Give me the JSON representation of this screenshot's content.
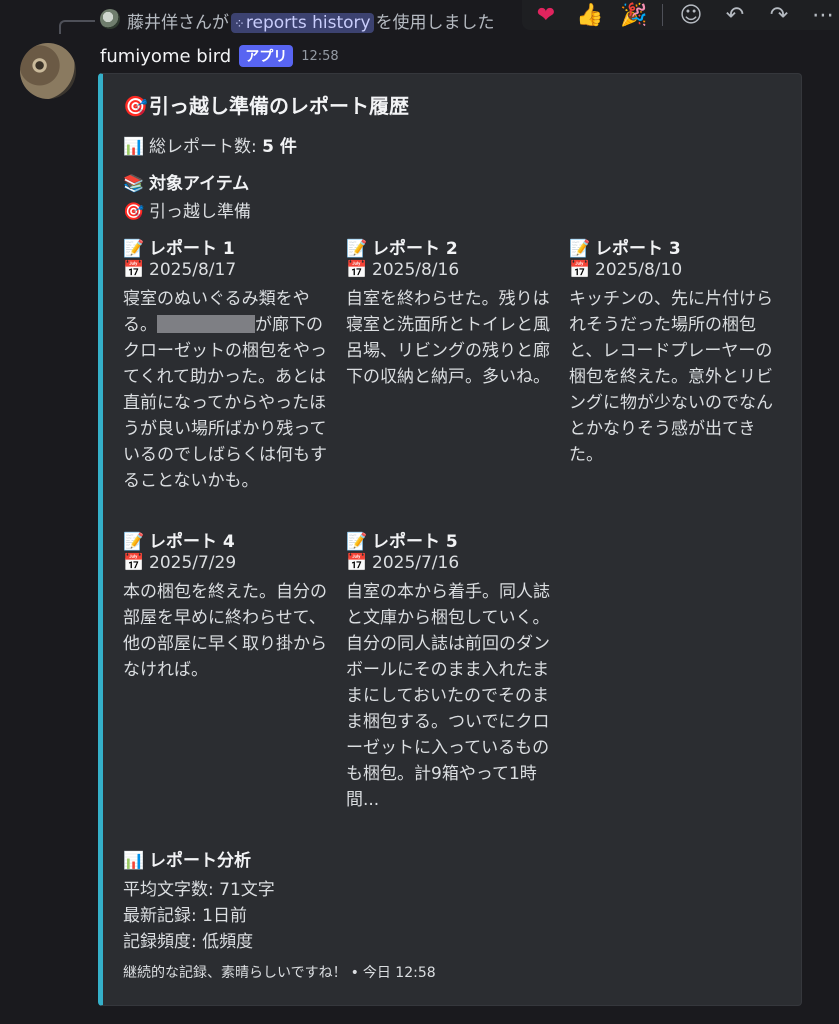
{
  "reply": {
    "user_text": "藤井佯さんが",
    "command": "reports history",
    "suffix": "を使用しました"
  },
  "toolbar": {
    "reactions": [
      "heart",
      "thumbs-up",
      "party-popper"
    ],
    "actions": [
      "add-reaction",
      "reply",
      "forward",
      "more"
    ]
  },
  "message": {
    "author": "fumiyome bird",
    "badge": "アプリ",
    "time": "12:58"
  },
  "embed": {
    "accent_color": "#35b0c9",
    "title": "引っ越し準備のレポート履歴",
    "total_label": "総レポート数:",
    "total_value": "5 件",
    "target_heading": "対象アイテム",
    "target_item": "引っ越し準備",
    "reports": [
      {
        "name": "レポート 1",
        "date": "2025/8/17",
        "text_before": "寝室のぬいぐるみ類をやる。",
        "text_after": "が廊下のクローゼットの梱包をやってくれて助かった。あとは直前になってからやったほうが良い場所ばかり残っているのでしばらくは何もすることないかも。"
      },
      {
        "name": "レポート 2",
        "date": "2025/8/16",
        "text": "自室を終わらせた。残りは寝室と洗面所とトイレと風呂場、リビングの残りと廊下の収納と納戸。多いね。"
      },
      {
        "name": "レポート 3",
        "date": "2025/8/10",
        "text": "キッチンの、先に片付けられそうだった場所の梱包と、レコードプレーヤーの梱包を終えた。意外とリビングに物が少ないのでなんとかなりそう感が出てきた。"
      },
      {
        "name": "レポート 4",
        "date": "2025/7/29",
        "text": "本の梱包を終えた。自分の部屋を早めに終わらせて、他の部屋に早く取り掛からなければ。"
      },
      {
        "name": "レポート 5",
        "date": "2025/7/16",
        "text": "自室の本から着手。同人誌と文庫から梱包していく。自分の同人誌は前回のダンボールにそのまま入れたままにしておいたのでそのまま梱包する。ついでにクローゼットに入っているものも梱包。計9箱やって1時間..."
      }
    ],
    "analysis": {
      "heading": "レポート分析",
      "avg_chars": "平均文字数: 71文字",
      "latest": "最新記録: 1日前",
      "frequency": "記録頻度: 低頻度"
    },
    "footer_text": "継続的な記録、素晴らしいですね！",
    "footer_sep": "•",
    "footer_time": "今日 12:58"
  },
  "icons": {
    "target": "🎯",
    "chart": "📊",
    "books": "📚",
    "memo": "📝",
    "calendar": "📅"
  }
}
